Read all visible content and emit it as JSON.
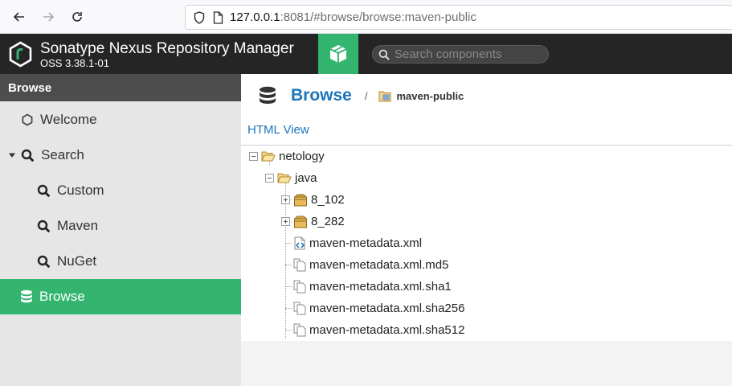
{
  "browser": {
    "url_host": "127.0.0.1",
    "url_rest": ":8081/#browse/browse:maven-public"
  },
  "header": {
    "title": "Sonatype Nexus Repository Manager",
    "version": "OSS 3.38.1-01",
    "search_placeholder": "Search components",
    "accent_color": "#33b56f"
  },
  "sidebar": {
    "heading": "Browse",
    "items": [
      {
        "label": "Welcome",
        "icon": "hexagon-icon"
      },
      {
        "label": "Search",
        "icon": "search-icon"
      },
      {
        "label": "Custom",
        "icon": "search-icon"
      },
      {
        "label": "Maven",
        "icon": "search-icon"
      },
      {
        "label": "NuGet",
        "icon": "search-icon"
      },
      {
        "label": "Browse",
        "icon": "database-icon",
        "active": true
      }
    ]
  },
  "main": {
    "breadcrumb_title": "Browse",
    "breadcrumb_sep": "/",
    "repository": "maven-public",
    "html_view_link": "HTML View",
    "tree": [
      {
        "label": "netology",
        "type": "folder-open"
      },
      {
        "label": "java",
        "type": "folder-open"
      },
      {
        "label": "8_102",
        "type": "component"
      },
      {
        "label": "8_282",
        "type": "component"
      },
      {
        "label": "maven-metadata.xml",
        "type": "xml-file"
      },
      {
        "label": "maven-metadata.xml.md5",
        "type": "file"
      },
      {
        "label": "maven-metadata.xml.sha1",
        "type": "file"
      },
      {
        "label": "maven-metadata.xml.sha256",
        "type": "file"
      },
      {
        "label": "maven-metadata.xml.sha512",
        "type": "file"
      }
    ]
  }
}
